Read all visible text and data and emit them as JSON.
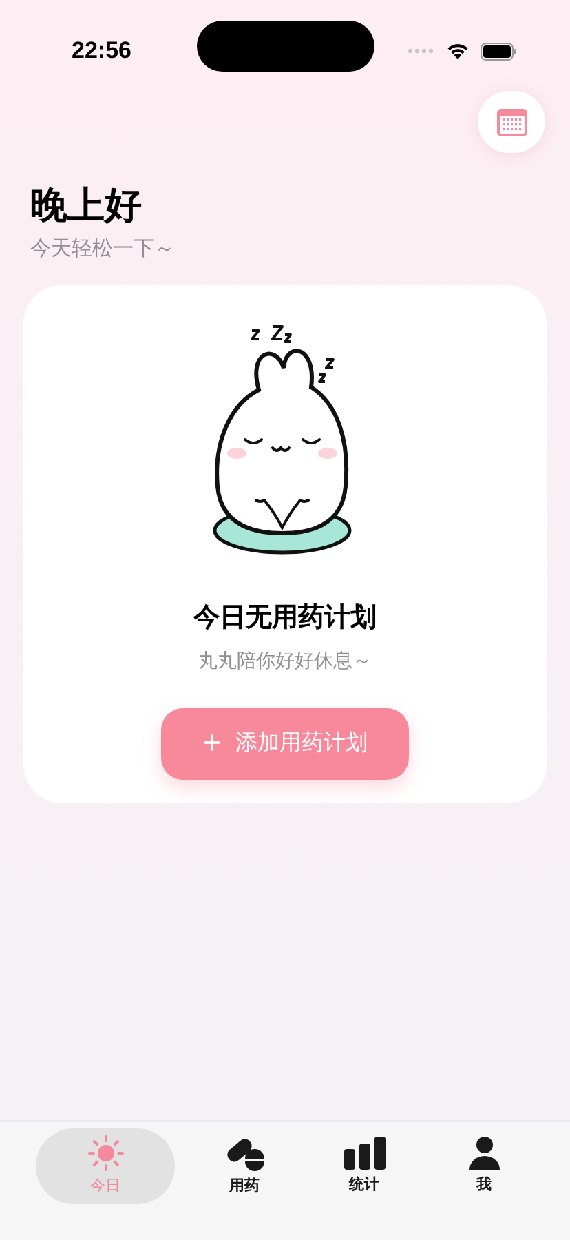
{
  "status_bar": {
    "time": "22:56"
  },
  "header": {
    "greeting": "晚上好",
    "subtitle": "今天轻松一下～"
  },
  "empty_state": {
    "title": "今日无用药计划",
    "message": "丸丸陪你好好休息～",
    "button": {
      "icon": "+",
      "label": "添加用药计划"
    }
  },
  "tab_bar": [
    {
      "kind": "sun",
      "label": "今日",
      "selected": true
    },
    {
      "kind": "pill",
      "label": "用药",
      "selected": false
    },
    {
      "kind": "chart",
      "label": "统计",
      "selected": false
    },
    {
      "kind": "person",
      "label": "我",
      "selected": false
    }
  ]
}
